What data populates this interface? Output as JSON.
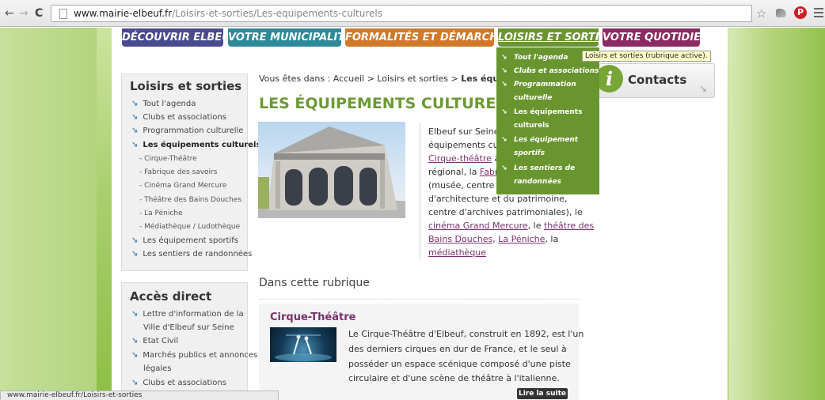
{
  "browser": {
    "url_host": "www.mairie-elbeuf.fr",
    "url_path": "/Loisirs-et-sorties/Les-equipements-culturels",
    "status_text": "www.mairie-elbeuf.fr/Loisirs-et-sorties"
  },
  "topnav": {
    "items": [
      {
        "label": "DÉCOUVRIR ELBEUF",
        "color": "#4a4a8e"
      },
      {
        "label": "VOTRE MUNICIPALITÉ",
        "color": "#2e8a98"
      },
      {
        "label": "FORMALITÉS ET DÉMARCHES",
        "color": "#d07928"
      },
      {
        "label": "LOISIRS ET SORTIES",
        "color": "#6a9530"
      },
      {
        "label": "VOTRE QUOTIDIEN",
        "color": "#8b2a63"
      }
    ]
  },
  "dropdown": {
    "items": [
      {
        "line1": "Tout l'agenda",
        "line2": ""
      },
      {
        "line1": "Clubs et associations",
        "line2": ""
      },
      {
        "line1": "Programmation",
        "line2": "culturelle"
      },
      {
        "line1": "Les équipements",
        "line2": "culturels"
      },
      {
        "line1": "Les équipement",
        "line2": "sportifs"
      },
      {
        "line1": "Les sentiers de",
        "line2": "randonnées"
      }
    ]
  },
  "tooltip": "Loisirs et sorties (rubrique active).",
  "sidebar": {
    "title": "Loisirs et sorties",
    "items": [
      "Tout l'agenda",
      "Clubs et associations",
      "Programmation culturelle",
      "Les équipements culturels"
    ],
    "sub_items": [
      "Cirque-Théâtre",
      "Fabrique des savoirs",
      "Cinéma Grand Mercure",
      "Théâtre des Bains Douches",
      "La Péniche",
      "Médiathèque / Ludothèque"
    ],
    "items_after": [
      "Les équipement sportifs",
      "Les sentiers de randonnées"
    ]
  },
  "acces": {
    "title": "Accès direct",
    "items": [
      "Lettre d'information de la",
      "Ville d'Elbeuf sur Seine",
      "Etat Civil",
      "Marchés publics et annonces",
      "légales",
      "Clubs et associations"
    ]
  },
  "breadcrumb": {
    "prefix": "Vous êtes dans : Accueil > Loisirs et sorties > ",
    "current": "Les équipements culturels"
  },
  "main": {
    "title": "LES ÉQUIPEMENTS CULTURELS",
    "intro": {
      "l1": "Elbeuf sur Seine a",
      "l2": "équipements cult",
      "l3a": "Cirque-théâtre",
      "l3b": " au",
      "l4a": "régional, la ",
      "l4b": "Fabri",
      "l5": "(musée, centre d'",
      "l6": "d'architecture et du patrimoine,",
      "l7": "centre d'archives patrimoniales), le",
      "l8a": "cinéma Grand Mercure",
      "l8b": ", le ",
      "l8c": "théâtre des",
      "l9a": "Bains Douches",
      "l9b": ", ",
      "l9c": "La Péniche",
      "l9d": ", la",
      "l10": "médiathèque"
    },
    "rubrique_title": "Dans cette rubrique",
    "cirque": {
      "title": "Cirque-Théâtre",
      "lines": [
        "Le Cirque-Théâtre d'Elbeuf, construit en 1892, est l'un",
        "des derniers cirques en dur de France, et le seul à",
        "posséder un espace scénique composé d'une piste",
        "circulaire et d'une scène de théâtre à l'italienne."
      ],
      "read_more": "Lire la suite"
    }
  },
  "contacts": {
    "label": "Contacts",
    "icon_letter": "i"
  },
  "icons": {
    "arrow": "↘"
  }
}
